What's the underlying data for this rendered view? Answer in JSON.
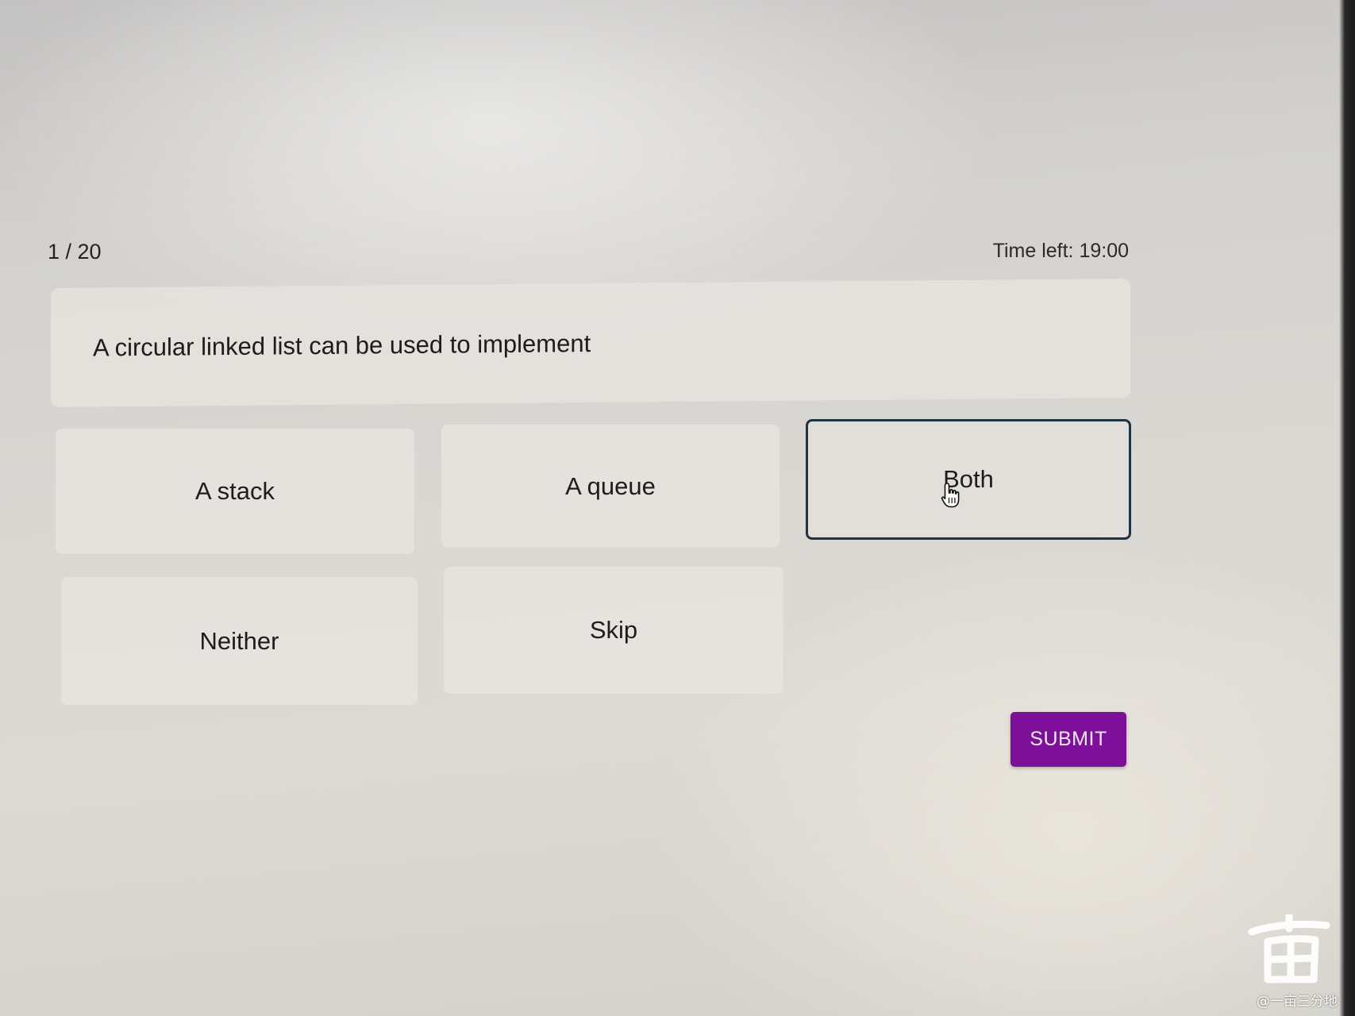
{
  "quiz": {
    "progress": "1 / 20",
    "timer": "Time left: 19:00",
    "question": "A circular linked list can be used to implement",
    "options": [
      {
        "label": "A stack",
        "selected": false
      },
      {
        "label": "A queue",
        "selected": false
      },
      {
        "label": "Both",
        "selected": true
      },
      {
        "label": "Neither",
        "selected": false
      },
      {
        "label": "Skip",
        "selected": false
      }
    ],
    "submit_label": "SUBMIT"
  },
  "watermark": {
    "text": "@一亩三分地"
  },
  "colors": {
    "submit_bg": "#7d0f9b",
    "selected_border": "#1f3440",
    "option_bg": "#e5e3de"
  },
  "icons": {
    "cursor": "hand-pointer-icon"
  }
}
